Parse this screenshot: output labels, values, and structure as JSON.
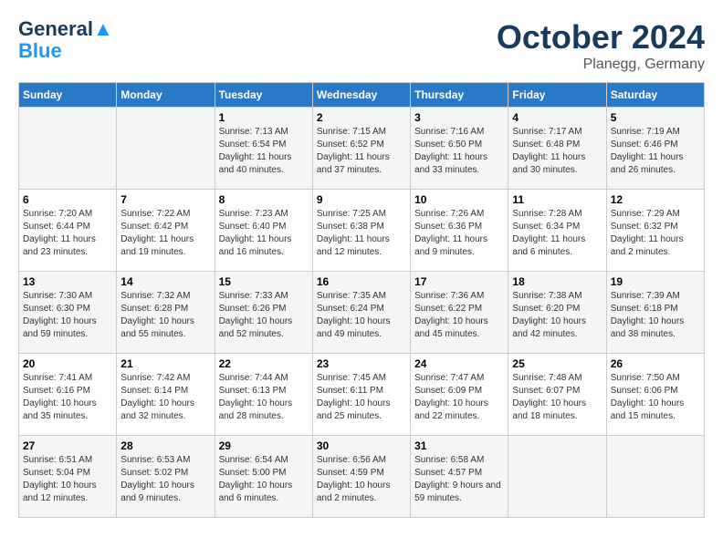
{
  "header": {
    "logo_line1": "General",
    "logo_line2": "Blue",
    "month": "October 2024",
    "location": "Planegg, Germany"
  },
  "days_of_week": [
    "Sunday",
    "Monday",
    "Tuesday",
    "Wednesday",
    "Thursday",
    "Friday",
    "Saturday"
  ],
  "weeks": [
    [
      {
        "day": "",
        "info": ""
      },
      {
        "day": "",
        "info": ""
      },
      {
        "day": "1",
        "info": "Sunrise: 7:13 AM\nSunset: 6:54 PM\nDaylight: 11 hours and 40 minutes."
      },
      {
        "day": "2",
        "info": "Sunrise: 7:15 AM\nSunset: 6:52 PM\nDaylight: 11 hours and 37 minutes."
      },
      {
        "day": "3",
        "info": "Sunrise: 7:16 AM\nSunset: 6:50 PM\nDaylight: 11 hours and 33 minutes."
      },
      {
        "day": "4",
        "info": "Sunrise: 7:17 AM\nSunset: 6:48 PM\nDaylight: 11 hours and 30 minutes."
      },
      {
        "day": "5",
        "info": "Sunrise: 7:19 AM\nSunset: 6:46 PM\nDaylight: 11 hours and 26 minutes."
      }
    ],
    [
      {
        "day": "6",
        "info": "Sunrise: 7:20 AM\nSunset: 6:44 PM\nDaylight: 11 hours and 23 minutes."
      },
      {
        "day": "7",
        "info": "Sunrise: 7:22 AM\nSunset: 6:42 PM\nDaylight: 11 hours and 19 minutes."
      },
      {
        "day": "8",
        "info": "Sunrise: 7:23 AM\nSunset: 6:40 PM\nDaylight: 11 hours and 16 minutes."
      },
      {
        "day": "9",
        "info": "Sunrise: 7:25 AM\nSunset: 6:38 PM\nDaylight: 11 hours and 12 minutes."
      },
      {
        "day": "10",
        "info": "Sunrise: 7:26 AM\nSunset: 6:36 PM\nDaylight: 11 hours and 9 minutes."
      },
      {
        "day": "11",
        "info": "Sunrise: 7:28 AM\nSunset: 6:34 PM\nDaylight: 11 hours and 6 minutes."
      },
      {
        "day": "12",
        "info": "Sunrise: 7:29 AM\nSunset: 6:32 PM\nDaylight: 11 hours and 2 minutes."
      }
    ],
    [
      {
        "day": "13",
        "info": "Sunrise: 7:30 AM\nSunset: 6:30 PM\nDaylight: 10 hours and 59 minutes."
      },
      {
        "day": "14",
        "info": "Sunrise: 7:32 AM\nSunset: 6:28 PM\nDaylight: 10 hours and 55 minutes."
      },
      {
        "day": "15",
        "info": "Sunrise: 7:33 AM\nSunset: 6:26 PM\nDaylight: 10 hours and 52 minutes."
      },
      {
        "day": "16",
        "info": "Sunrise: 7:35 AM\nSunset: 6:24 PM\nDaylight: 10 hours and 49 minutes."
      },
      {
        "day": "17",
        "info": "Sunrise: 7:36 AM\nSunset: 6:22 PM\nDaylight: 10 hours and 45 minutes."
      },
      {
        "day": "18",
        "info": "Sunrise: 7:38 AM\nSunset: 6:20 PM\nDaylight: 10 hours and 42 minutes."
      },
      {
        "day": "19",
        "info": "Sunrise: 7:39 AM\nSunset: 6:18 PM\nDaylight: 10 hours and 38 minutes."
      }
    ],
    [
      {
        "day": "20",
        "info": "Sunrise: 7:41 AM\nSunset: 6:16 PM\nDaylight: 10 hours and 35 minutes."
      },
      {
        "day": "21",
        "info": "Sunrise: 7:42 AM\nSunset: 6:14 PM\nDaylight: 10 hours and 32 minutes."
      },
      {
        "day": "22",
        "info": "Sunrise: 7:44 AM\nSunset: 6:13 PM\nDaylight: 10 hours and 28 minutes."
      },
      {
        "day": "23",
        "info": "Sunrise: 7:45 AM\nSunset: 6:11 PM\nDaylight: 10 hours and 25 minutes."
      },
      {
        "day": "24",
        "info": "Sunrise: 7:47 AM\nSunset: 6:09 PM\nDaylight: 10 hours and 22 minutes."
      },
      {
        "day": "25",
        "info": "Sunrise: 7:48 AM\nSunset: 6:07 PM\nDaylight: 10 hours and 18 minutes."
      },
      {
        "day": "26",
        "info": "Sunrise: 7:50 AM\nSunset: 6:06 PM\nDaylight: 10 hours and 15 minutes."
      }
    ],
    [
      {
        "day": "27",
        "info": "Sunrise: 6:51 AM\nSunset: 5:04 PM\nDaylight: 10 hours and 12 minutes."
      },
      {
        "day": "28",
        "info": "Sunrise: 6:53 AM\nSunset: 5:02 PM\nDaylight: 10 hours and 9 minutes."
      },
      {
        "day": "29",
        "info": "Sunrise: 6:54 AM\nSunset: 5:00 PM\nDaylight: 10 hours and 6 minutes."
      },
      {
        "day": "30",
        "info": "Sunrise: 6:56 AM\nSunset: 4:59 PM\nDaylight: 10 hours and 2 minutes."
      },
      {
        "day": "31",
        "info": "Sunrise: 6:58 AM\nSunset: 4:57 PM\nDaylight: 9 hours and 59 minutes."
      },
      {
        "day": "",
        "info": ""
      },
      {
        "day": "",
        "info": ""
      }
    ]
  ]
}
